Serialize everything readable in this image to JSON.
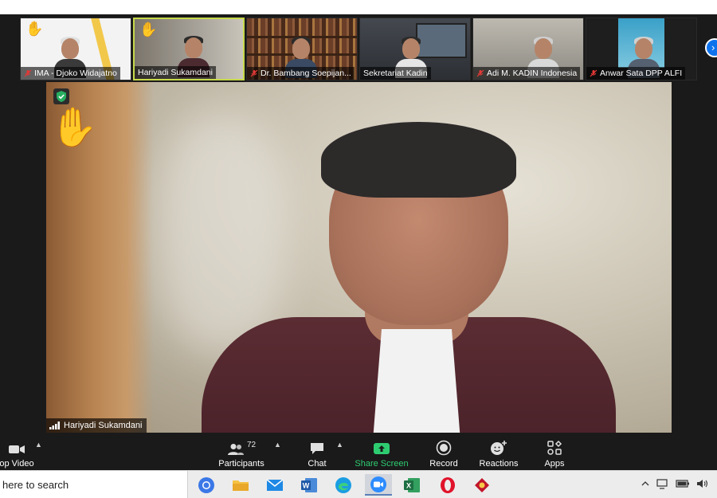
{
  "participants_strip": [
    {
      "name": "IMA - Djoko Widajatno",
      "muted": true,
      "hand_raised": true,
      "bg": "#f3f3f3",
      "accent": "#f2c84b",
      "suit": "#3a3a3a"
    },
    {
      "name": "Hariyadi Sukamdani",
      "muted": false,
      "hand_raised": true,
      "active_speaker": true,
      "bg": "#9a958c",
      "suit": "#4b2a30"
    },
    {
      "name": "Dr. Bambang Soepijan...",
      "muted": true,
      "hand_raised": false,
      "bg": "#6b3e28",
      "suit": "#3a4a63"
    },
    {
      "name": "Sekretariat Kadin",
      "muted": false,
      "hand_raised": false,
      "bg": "#3a3d42",
      "suit": "#e6e6e6"
    },
    {
      "name": "Adi M. KADIN Indonesia",
      "muted": true,
      "hand_raised": false,
      "bg": "#a9a59d",
      "suit": "#d9d9d9"
    },
    {
      "name": "Anwar Sata DPP ALFI",
      "muted": true,
      "hand_raised": false,
      "bg": "#1e1e1e",
      "accent": "#3aa0c8",
      "suit": "#556070"
    }
  ],
  "main_video": {
    "speaker_name": "Hariyadi Sukamdani",
    "hand_raised": true,
    "hand_emoji": "✋"
  },
  "toolbar": {
    "video_label": "op Video",
    "participants_label": "Participants",
    "participants_count": "72",
    "chat_label": "Chat",
    "share_label": "Share Screen",
    "record_label": "Record",
    "reactions_label": "Reactions",
    "apps_label": "Apps",
    "share_color": "#2ecc71"
  },
  "taskbar": {
    "search_text": "here to search",
    "apps": [
      "chrome-icon",
      "file-explorer-icon",
      "mail-icon",
      "word-icon",
      "edge-icon",
      "zoom-icon",
      "excel-icon",
      "opera-icon",
      "game-icon"
    ],
    "tray": [
      "chevron-up-icon",
      "network-icon",
      "battery-icon",
      "volume-icon"
    ]
  }
}
